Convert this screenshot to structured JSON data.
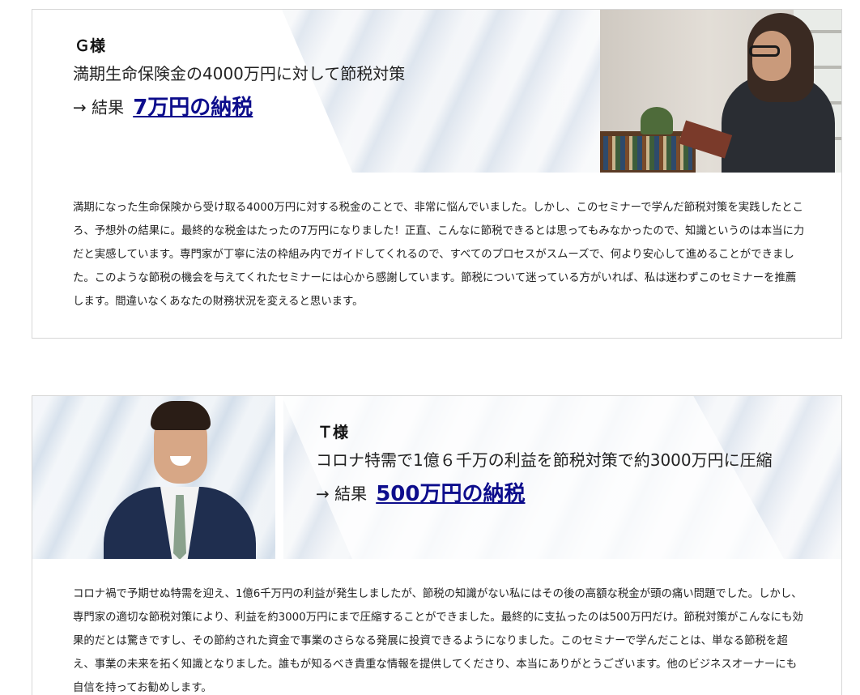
{
  "testimonials": [
    {
      "name": "Ｇ様",
      "subtitle": "満期生命保険金の4000万円に対して節税対策",
      "result_prefix": "→ 結果",
      "result_link": "7万円の納税",
      "body": "満期になった生命保険から受け取る4000万円に対する税金のことで、非常に悩んでいました。しかし、このセミナーで学んだ節税対策を実践したところ、予想外の結果に。最終的な税金はたったの7万円になりました！正直、こんなに節税できるとは思ってもみなかったので、知識というのは本当に力だと実感しています。専門家が丁寧に法の枠組み内でガイドしてくれるので、すべてのプロセスがスムーズで、何より安心して進めることができました。このような節税の機会を与えてくれたセミナーには心から感謝しています。節税について迷っている方がいれば、私は迷わずこのセミナーを推薦します。間違いなくあなたの財務状況を変えると思います。"
    },
    {
      "name": "Ｔ様",
      "subtitle": "コロナ特需で1億６千万の利益を節税対策で約3000万円に圧縮",
      "result_prefix": "→ 結果",
      "result_link": "500万円の納税",
      "body": "コロナ禍で予期せぬ特需を迎え、1億6千万円の利益が発生しましたが、節税の知識がない私にはその後の高額な税金が頭の痛い問題でした。しかし、専門家の適切な節税対策により、利益を約3000万円にまで圧縮することができました。最終的に支払ったのは500万円だけ。節税対策がこんなにも効果的だとは驚きですし、その節約された資金で事業のさらなる発展に投資できるようになりました。このセミナーで学んだことは、単なる節税を超え、事業の未来を拓く知識となりました。誰もが知るべき貴重な情報を提供してくださり、本当にありがとうございます。他のビジネスオーナーにも自信を持ってお勧めします。"
    }
  ],
  "colors": {
    "link": "#0d0d8c",
    "border": "#d6d6d6",
    "text": "#222222"
  }
}
